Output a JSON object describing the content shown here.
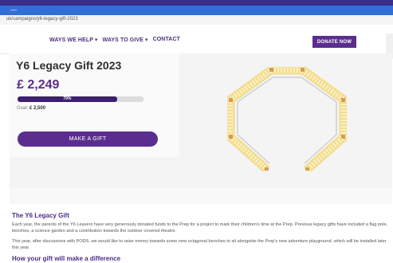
{
  "browser": {
    "mark": "—",
    "url": "uk/campaigns/y6-legacy-gift-2023"
  },
  "nav": {
    "items": [
      "WAYS WE HELP ▾",
      "WAYS TO GIVE ▾",
      "CONTACT"
    ],
    "donate_label": "DONATE NOW"
  },
  "campaign": {
    "title": "Y6 Legacy Gift 2023",
    "amount": "£ 2,249",
    "progress_label": "79%",
    "progress_fraction": 0.79,
    "goal_prefix": "Goal: ",
    "goal_value": "£ 2,500",
    "cta_label": "MAKE A GIFT"
  },
  "content": {
    "heading": "The Y6 Legacy Gift",
    "paragraph1": "Each year, the parents of the Y6 Leavers have very generously donated funds to the Prep for a project to mark their children's time at the Prep. Previous legacy gifts have included a flag pole, benches, a science garden and a contribution towards the outdoor covered theatre.",
    "paragraph2": "This year, after discussions with PODS, we would like to raise money towards some new octagonal benches to sit alongside the Prep's new adventure playground, which will be installed later this year.",
    "heading2": "How your gift will make a difference"
  },
  "colors": {
    "brand": "#5b2d8e",
    "bar": "#3d1f6e",
    "bench_wood": "#f7e7a8"
  }
}
